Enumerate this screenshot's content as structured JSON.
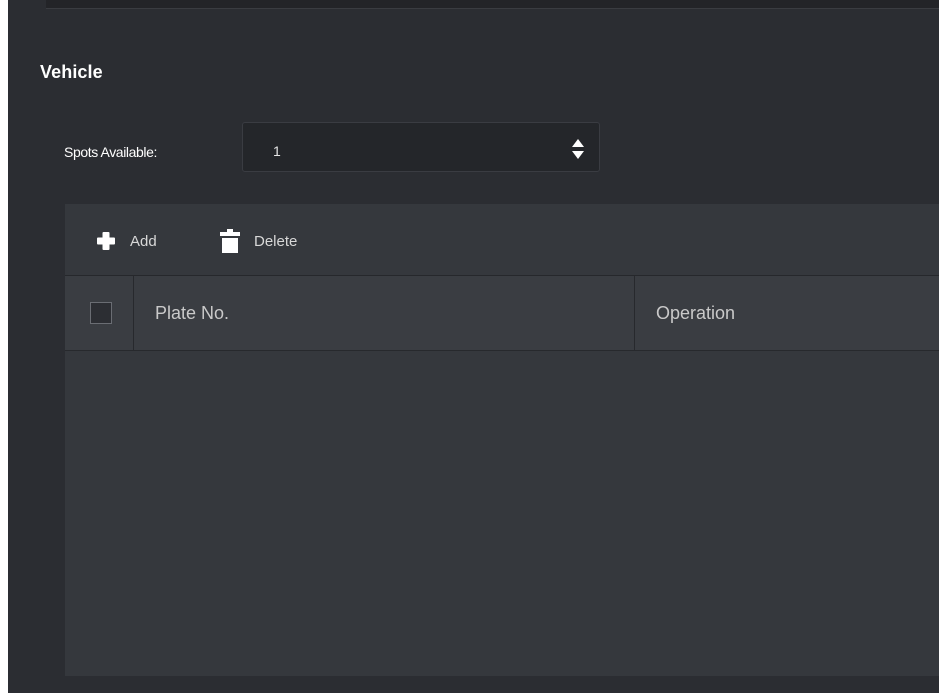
{
  "section": {
    "title": "Vehicle"
  },
  "spots": {
    "label": "Spots Available:",
    "value": "1"
  },
  "toolbar": {
    "add_label": "Add",
    "delete_label": "Delete"
  },
  "table": {
    "columns": [
      "Plate No.",
      "Operation"
    ],
    "rows": []
  },
  "colors": {
    "panel_bg": "#2b2d32",
    "table_bg": "#35383d",
    "header_bg": "#3a3d42",
    "text": "#ffffff",
    "muted_text": "#c9c9c9"
  },
  "icons": {
    "add": "plus-icon",
    "delete": "trash-icon",
    "spin": "spin-updown-icon"
  }
}
